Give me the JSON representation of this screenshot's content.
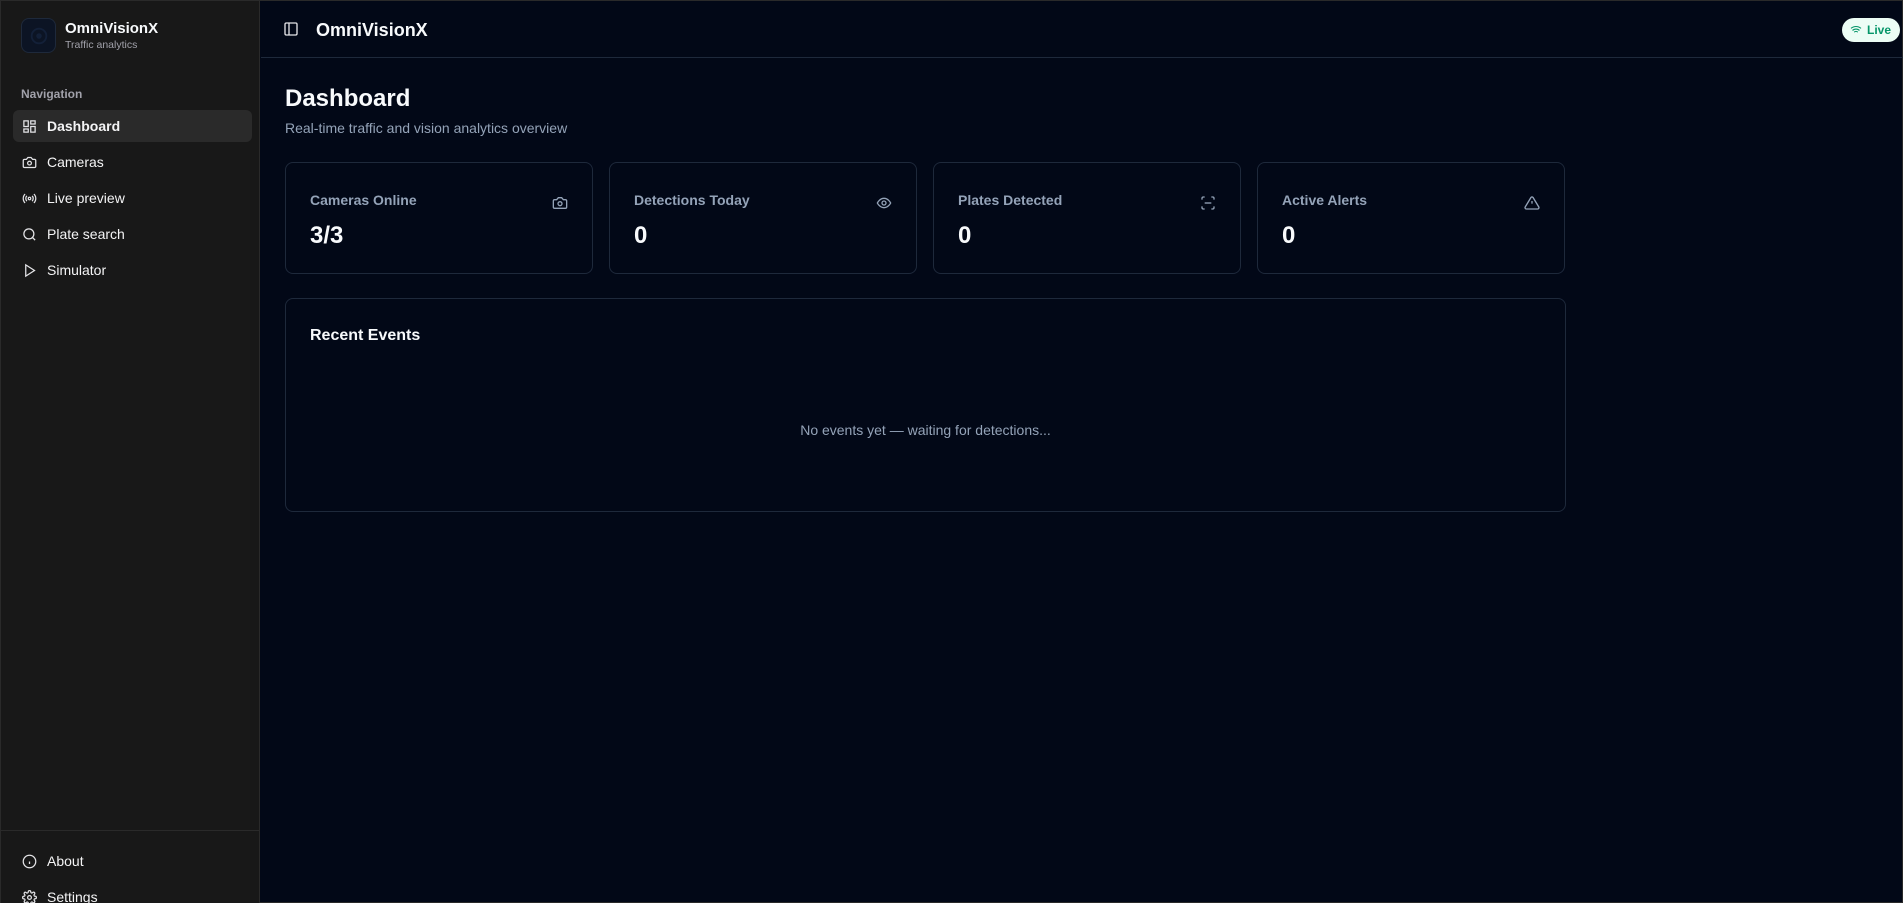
{
  "app": {
    "name": "OmniVisionX",
    "subtitle": "Traffic analytics"
  },
  "sidebar": {
    "heading": "Navigation",
    "items": [
      {
        "label": "Dashboard",
        "icon": "dashboard-icon",
        "active": true
      },
      {
        "label": "Cameras",
        "icon": "camera-icon"
      },
      {
        "label": "Live preview",
        "icon": "broadcast-icon"
      },
      {
        "label": "Plate search",
        "icon": "search-icon"
      },
      {
        "label": "Simulator",
        "icon": "play-icon"
      }
    ],
    "footer": [
      {
        "label": "About",
        "icon": "info-icon"
      },
      {
        "label": "Settings",
        "icon": "gear-icon"
      }
    ]
  },
  "header": {
    "title": "OmniVisionX",
    "status": "Live"
  },
  "page": {
    "title": "Dashboard",
    "subtitle": "Real-time traffic and vision analytics overview"
  },
  "stats": [
    {
      "label": "Cameras Online",
      "value": "3/3",
      "icon": "camera-icon"
    },
    {
      "label": "Detections Today",
      "value": "0",
      "icon": "eye-icon"
    },
    {
      "label": "Plates Detected",
      "value": "0",
      "icon": "scan-icon"
    },
    {
      "label": "Active Alerts",
      "value": "0",
      "icon": "alert-triangle-icon"
    }
  ],
  "events": {
    "title": "Recent Events",
    "empty_message": "No events yet — waiting for detections..."
  },
  "colors": {
    "background": "#020817",
    "sidebar": "#181818",
    "live_accent": "#059669"
  }
}
